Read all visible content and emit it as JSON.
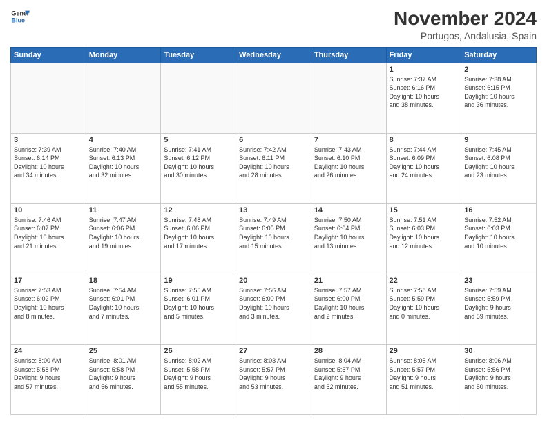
{
  "header": {
    "logo_line1": "General",
    "logo_line2": "Blue",
    "month": "November 2024",
    "location": "Portugos, Andalusia, Spain"
  },
  "weekdays": [
    "Sunday",
    "Monday",
    "Tuesday",
    "Wednesday",
    "Thursday",
    "Friday",
    "Saturday"
  ],
  "weeks": [
    [
      {
        "day": "",
        "info": ""
      },
      {
        "day": "",
        "info": ""
      },
      {
        "day": "",
        "info": ""
      },
      {
        "day": "",
        "info": ""
      },
      {
        "day": "",
        "info": ""
      },
      {
        "day": "1",
        "info": "Sunrise: 7:37 AM\nSunset: 6:16 PM\nDaylight: 10 hours\nand 38 minutes."
      },
      {
        "day": "2",
        "info": "Sunrise: 7:38 AM\nSunset: 6:15 PM\nDaylight: 10 hours\nand 36 minutes."
      }
    ],
    [
      {
        "day": "3",
        "info": "Sunrise: 7:39 AM\nSunset: 6:14 PM\nDaylight: 10 hours\nand 34 minutes."
      },
      {
        "day": "4",
        "info": "Sunrise: 7:40 AM\nSunset: 6:13 PM\nDaylight: 10 hours\nand 32 minutes."
      },
      {
        "day": "5",
        "info": "Sunrise: 7:41 AM\nSunset: 6:12 PM\nDaylight: 10 hours\nand 30 minutes."
      },
      {
        "day": "6",
        "info": "Sunrise: 7:42 AM\nSunset: 6:11 PM\nDaylight: 10 hours\nand 28 minutes."
      },
      {
        "day": "7",
        "info": "Sunrise: 7:43 AM\nSunset: 6:10 PM\nDaylight: 10 hours\nand 26 minutes."
      },
      {
        "day": "8",
        "info": "Sunrise: 7:44 AM\nSunset: 6:09 PM\nDaylight: 10 hours\nand 24 minutes."
      },
      {
        "day": "9",
        "info": "Sunrise: 7:45 AM\nSunset: 6:08 PM\nDaylight: 10 hours\nand 23 minutes."
      }
    ],
    [
      {
        "day": "10",
        "info": "Sunrise: 7:46 AM\nSunset: 6:07 PM\nDaylight: 10 hours\nand 21 minutes."
      },
      {
        "day": "11",
        "info": "Sunrise: 7:47 AM\nSunset: 6:06 PM\nDaylight: 10 hours\nand 19 minutes."
      },
      {
        "day": "12",
        "info": "Sunrise: 7:48 AM\nSunset: 6:06 PM\nDaylight: 10 hours\nand 17 minutes."
      },
      {
        "day": "13",
        "info": "Sunrise: 7:49 AM\nSunset: 6:05 PM\nDaylight: 10 hours\nand 15 minutes."
      },
      {
        "day": "14",
        "info": "Sunrise: 7:50 AM\nSunset: 6:04 PM\nDaylight: 10 hours\nand 13 minutes."
      },
      {
        "day": "15",
        "info": "Sunrise: 7:51 AM\nSunset: 6:03 PM\nDaylight: 10 hours\nand 12 minutes."
      },
      {
        "day": "16",
        "info": "Sunrise: 7:52 AM\nSunset: 6:03 PM\nDaylight: 10 hours\nand 10 minutes."
      }
    ],
    [
      {
        "day": "17",
        "info": "Sunrise: 7:53 AM\nSunset: 6:02 PM\nDaylight: 10 hours\nand 8 minutes."
      },
      {
        "day": "18",
        "info": "Sunrise: 7:54 AM\nSunset: 6:01 PM\nDaylight: 10 hours\nand 7 minutes."
      },
      {
        "day": "19",
        "info": "Sunrise: 7:55 AM\nSunset: 6:01 PM\nDaylight: 10 hours\nand 5 minutes."
      },
      {
        "day": "20",
        "info": "Sunrise: 7:56 AM\nSunset: 6:00 PM\nDaylight: 10 hours\nand 3 minutes."
      },
      {
        "day": "21",
        "info": "Sunrise: 7:57 AM\nSunset: 6:00 PM\nDaylight: 10 hours\nand 2 minutes."
      },
      {
        "day": "22",
        "info": "Sunrise: 7:58 AM\nSunset: 5:59 PM\nDaylight: 10 hours\nand 0 minutes."
      },
      {
        "day": "23",
        "info": "Sunrise: 7:59 AM\nSunset: 5:59 PM\nDaylight: 9 hours\nand 59 minutes."
      }
    ],
    [
      {
        "day": "24",
        "info": "Sunrise: 8:00 AM\nSunset: 5:58 PM\nDaylight: 9 hours\nand 57 minutes."
      },
      {
        "day": "25",
        "info": "Sunrise: 8:01 AM\nSunset: 5:58 PM\nDaylight: 9 hours\nand 56 minutes."
      },
      {
        "day": "26",
        "info": "Sunrise: 8:02 AM\nSunset: 5:58 PM\nDaylight: 9 hours\nand 55 minutes."
      },
      {
        "day": "27",
        "info": "Sunrise: 8:03 AM\nSunset: 5:57 PM\nDaylight: 9 hours\nand 53 minutes."
      },
      {
        "day": "28",
        "info": "Sunrise: 8:04 AM\nSunset: 5:57 PM\nDaylight: 9 hours\nand 52 minutes."
      },
      {
        "day": "29",
        "info": "Sunrise: 8:05 AM\nSunset: 5:57 PM\nDaylight: 9 hours\nand 51 minutes."
      },
      {
        "day": "30",
        "info": "Sunrise: 8:06 AM\nSunset: 5:56 PM\nDaylight: 9 hours\nand 50 minutes."
      }
    ]
  ]
}
